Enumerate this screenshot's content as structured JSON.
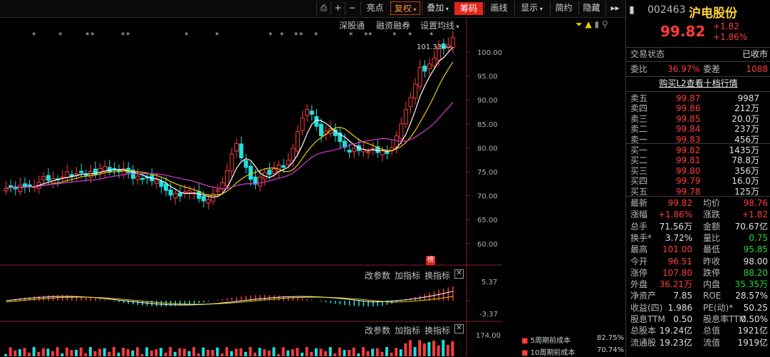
{
  "toolbar": {
    "items": [
      "亮点",
      "复权",
      "叠加",
      "筹码",
      "画线",
      "显示",
      "简约",
      "隐藏"
    ]
  },
  "chart_links": {
    "items": [
      "深股通",
      "融资融券",
      "设置均线"
    ]
  },
  "price_axis": [
    "100.00",
    "95.00",
    "90.00",
    "85.00",
    "80.00",
    "75.00",
    "70.00",
    "65.00",
    "60.00"
  ],
  "max_marker": "101.32",
  "badge": "榜",
  "sub1": {
    "links": [
      "改参数",
      "加指标",
      "换指标"
    ],
    "ticks": [
      "5.37",
      "-3.37"
    ]
  },
  "sub2": {
    "links": [
      "改参数",
      "加指标",
      "换指标"
    ],
    "ticks": [
      "174.00"
    ]
  },
  "cost": [
    {
      "label": "5周期前成本",
      "value": "82.75%"
    },
    {
      "label": "10周期前成本",
      "value": "70.74%"
    }
  ],
  "header": {
    "code": "002463",
    "name": "沪电股份",
    "price": "99.82",
    "change": "+1.82",
    "pct": "+1.86%"
  },
  "status": {
    "label": "交易状态",
    "value": "已收市"
  },
  "ratio": {
    "weibi_label": "委比",
    "weibi": "36.97%",
    "weicha_label": "委差",
    "weicha": "1088"
  },
  "l2_link": "购买L2查看十档行情",
  "asks": [
    {
      "label": "卖五",
      "price": "99.87",
      "vol": "9987"
    },
    {
      "label": "卖四",
      "price": "99.86",
      "vol": "212万"
    },
    {
      "label": "卖三",
      "price": "99.85",
      "vol": "20.0万"
    },
    {
      "label": "卖二",
      "price": "99.84",
      "vol": "237万"
    },
    {
      "label": "卖一",
      "price": "99.83",
      "vol": "456万"
    }
  ],
  "bids": [
    {
      "label": "买一",
      "price": "99.82",
      "vol": "1435万"
    },
    {
      "label": "买二",
      "price": "99.81",
      "vol": "78.8万"
    },
    {
      "label": "买三",
      "price": "99.80",
      "vol": "356万"
    },
    {
      "label": "买四",
      "price": "99.79",
      "vol": "16.0万"
    },
    {
      "label": "买五",
      "price": "99.78",
      "vol": "125万"
    }
  ],
  "stats": [
    {
      "l1": "最新",
      "v1": "99.82",
      "c1": "red",
      "l2": "均价",
      "v2": "98.76",
      "c2": "red"
    },
    {
      "l1": "涨幅",
      "v1": "+1.86%",
      "c1": "red",
      "l2": "涨跌",
      "v2": "+1.82",
      "c2": "red"
    },
    {
      "l1": "总手",
      "v1": "71.56万",
      "c1": "white",
      "l2": "金额",
      "v2": "70.67亿",
      "c2": "white"
    },
    {
      "l1": "换手*",
      "v1": "3.72%",
      "c1": "white",
      "l2": "量比",
      "v2": "0.75",
      "c2": "green"
    },
    {
      "l1": "最高",
      "v1": "101.00",
      "c1": "red",
      "l2": "最低",
      "v2": "95.85",
      "c2": "green"
    },
    {
      "l1": "今开",
      "v1": "96.51",
      "c1": "red",
      "l2": "昨收",
      "v2": "98.00",
      "c2": "white"
    },
    {
      "l1": "涨停",
      "v1": "107.80",
      "c1": "red",
      "l2": "跌停",
      "v2": "88.20",
      "c2": "green"
    },
    {
      "l1": "外盘",
      "v1": "36.21万",
      "c1": "red",
      "l2": "内盘",
      "v2": "35.35万",
      "c2": "green"
    },
    {
      "l1": "净资产",
      "v1": "7.85",
      "c1": "white",
      "l2": "ROE",
      "v2": "28.57%",
      "c2": "white"
    },
    {
      "l1": "收益(四)",
      "v1": "1.986",
      "c1": "white",
      "l2": "PE(动)*",
      "v2": "50.25",
      "c2": "white"
    },
    {
      "l1": "股息TTM",
      "v1": "0.50",
      "c1": "white",
      "l2": "股息率TTM",
      "v2": "0.50%",
      "c2": "white"
    },
    {
      "l1": "总股本",
      "v1": "19.24亿",
      "c1": "white",
      "l2": "总值",
      "v2": "1921亿",
      "c2": "white"
    },
    {
      "l1": "流通股",
      "v1": "19.23亿",
      "c1": "white",
      "l2": "流值",
      "v2": "1919亿",
      "c2": "white"
    }
  ],
  "colors": {
    "up": "#ff3b3b",
    "down": "#1ee0e0",
    "ma5": "#ffffff",
    "ma10": "#e8d200",
    "ma20": "#d23ccf"
  }
}
